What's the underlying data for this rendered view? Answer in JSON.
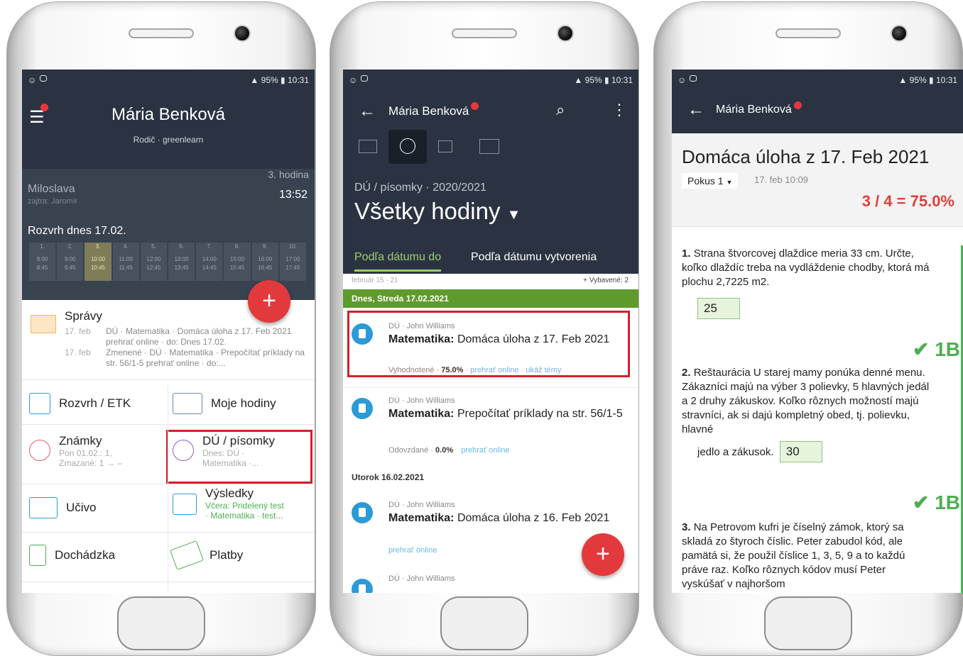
{
  "status": {
    "battery": "95%",
    "time": "10:31"
  },
  "p1": {
    "user": "Mária Benková",
    "role": "Rodič · greenlearn",
    "student": "Miloslava",
    "tomorrow": "zajtra: Jaromír",
    "lesson": "3. hodina",
    "clock": "13:52",
    "sched_title": "Rozvrh dnes 17.02.",
    "lessons": [
      "1.",
      "2.",
      "3.",
      "4.",
      "5.",
      "6.",
      "7.",
      "8.",
      "9.",
      "10."
    ],
    "times": [
      "8:00",
      "9:00",
      "10:00",
      "11:00",
      "12:00",
      "13:00",
      "14:00",
      "15:00",
      "16:00",
      "17:00"
    ],
    "ends": [
      "8:45",
      "9:45",
      "10:45",
      "11:45",
      "12:45",
      "13:45",
      "14:45",
      "15:45",
      "16:45",
      "17:45"
    ],
    "fab": "+",
    "msg": {
      "title": "Správy",
      "d1": "17. feb",
      "t1": "DÚ · Matematika · Domáca úloha z 17. Feb 2021 prehrať online · do: Dnes 17.02.",
      "d2": "17. feb",
      "t2": "Zmenené · DÚ · Matematika · Prepočítať príklady na str. 56/1-5 prehrať online · do:..."
    },
    "rozvrh": "Rozvrh / ETK",
    "hodiny": "Moje hodiny",
    "znamky": {
      "t": "Známky",
      "s1": "Pon 01.02.: 1,",
      "s2": "Zmazané: 1 → –"
    },
    "du": {
      "t": "DÚ / písomky",
      "s1": "Dnes: DÚ ·",
      "s2": "Matematika ·..."
    },
    "ucivo": "Učivo",
    "vysledky": {
      "t": "Výsledky",
      "s1": "Včera: Pridelený test",
      "s2": "· Matematika · test..."
    },
    "dochadzka": "Dochádzka",
    "platby": "Platby"
  },
  "p2": {
    "user": "Mária Benková",
    "crumb": "DÚ / písomky · 2020/2021",
    "heading": "Všetky hodiny",
    "tab1": "Podľa dátumu do",
    "tab2": "Podľa dátumu vytvorenia",
    "range": "február 15 - 21",
    "done": "+ Vybavené: 2",
    "today": "Dnes, Streda 17.02.2021",
    "i1": {
      "who": "DÚ · John Williams",
      "subject": "Matematika:",
      "title": "Domáca úloha z 17. Feb 2021",
      "state": "Vyhodnotené ·",
      "pct": "75.0%",
      "link1": "· prehrať online",
      "link2": "· ukáž témy"
    },
    "i2": {
      "who": "DÚ · John Williams",
      "subject": "Matematika:",
      "title": "Prepočítať príklady na str. 56/1-5",
      "state": "Odovzdané ·",
      "pct": "0.0%",
      "link1": "prehrať online"
    },
    "day2": "Utorok 16.02.2021",
    "i3": {
      "who": "DÚ · John Williams",
      "subject": "Matematika:",
      "title": "Domáca úloha z 16. Feb 2021",
      "link1": "prehrať online"
    },
    "i4": {
      "who": "DÚ · John Williams"
    },
    "fab": "+"
  },
  "p3": {
    "user": "Mária Benková",
    "title": "Domáca úloha z 17. Feb 2021",
    "attempt": "Pokus 1",
    "adate": "17. feb 10:09",
    "score": "3 / 4 = 75.0%",
    "q1": {
      "n": "1.",
      "text": "Strana štvorcovej dlaždice meria 33 cm. Určte, koľko dlaždíc treba na vydláždenie chodby, ktorá má plochu 2,7225 m2.",
      "ans": "25",
      "pts": "1B"
    },
    "q2": {
      "n": "2.",
      "text": "Reštaurácia U starej mamy ponúka denné menu. Zákazníci majú na výber 3 polievky, 5 hlavných jedál a 2 druhy zákuskov. Koľko rôznych možností majú stravníci, ak si dajú kompletný obed, tj. polievku, hlavné",
      "text2": "jedlo a zákusok.",
      "ans": "30",
      "pts": "1B"
    },
    "q3": {
      "n": "3.",
      "text": "Na Petrovom kufri je číselný zámok, ktorý sa skladá zo štyroch číslic. Peter zabudol kód, ale pamätá si, že použil číslice 1, 3, 5, 9 a to každú práve raz. Koľko rôznych kódov musí Peter vyskúšať v najhoršom"
    }
  }
}
